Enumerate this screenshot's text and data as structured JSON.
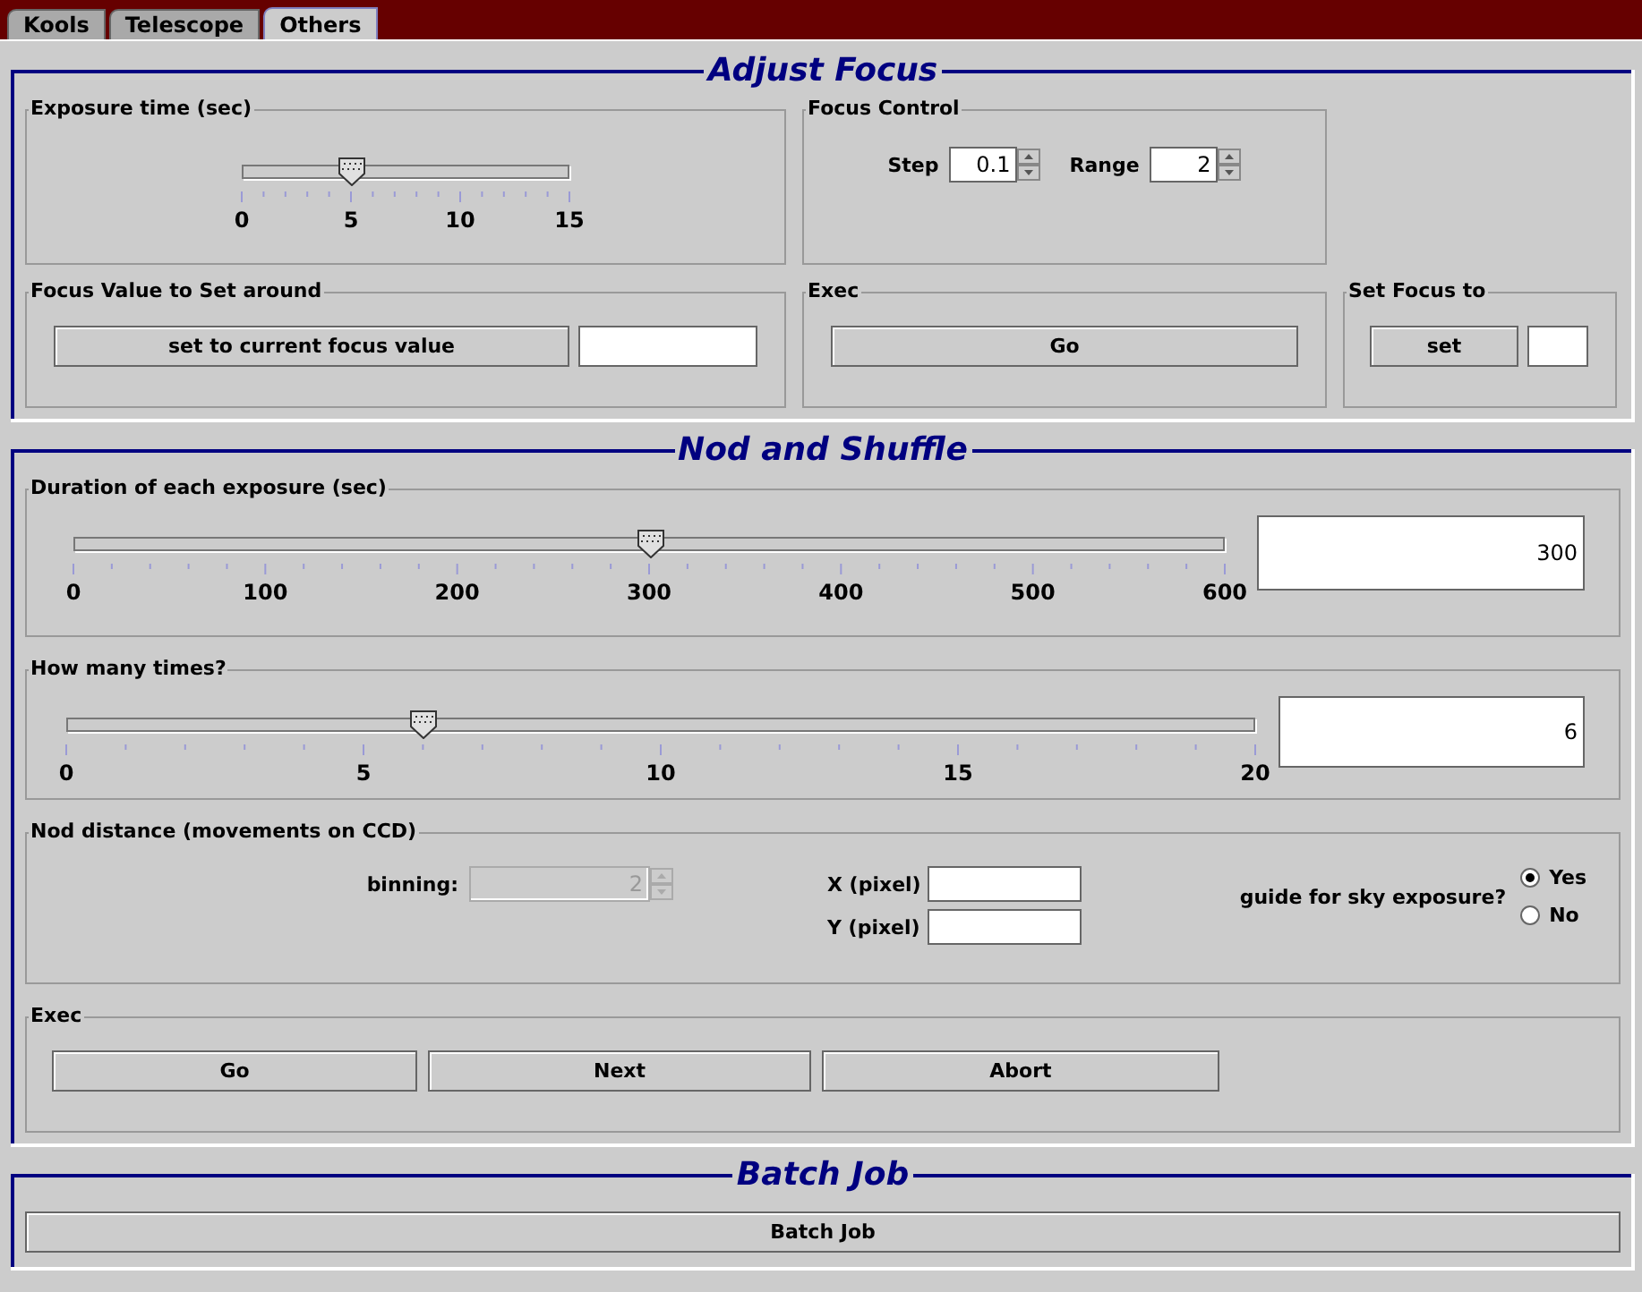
{
  "tabs": [
    {
      "label": "Kools",
      "selected": false
    },
    {
      "label": "Telescope",
      "selected": false
    },
    {
      "label": "Others",
      "selected": true
    }
  ],
  "adjust_focus": {
    "title": "Adjust Focus",
    "exposure": {
      "title": "Exposure time (sec)",
      "level": 0.333,
      "labels": [
        "0",
        "5",
        "10",
        "15"
      ]
    },
    "focus_control": {
      "title": "Focus Control",
      "spinners": [
        {
          "label": "Step",
          "value": "0.1"
        },
        {
          "label": "Range",
          "value": "2"
        }
      ]
    },
    "focus_value": {
      "title": "Focus Value to Set around",
      "button": "set to current focus value"
    },
    "exec": {
      "title": "Exec",
      "button": "Go"
    },
    "set_focus": {
      "title": "Set Focus to",
      "button": "set"
    }
  },
  "nod_and_shuffle": {
    "title": "Nod and Shuffle",
    "duration": {
      "title": "Duration of each exposure (sec)",
      "level": 0.5,
      "labels": [
        "0",
        "100",
        "200",
        "300",
        "400",
        "500",
        "600"
      ],
      "value": "300"
    },
    "times": {
      "title": "How many times?",
      "level": 0.3,
      "labels": [
        "0",
        "5",
        "10",
        "15",
        "20"
      ],
      "value": "6"
    },
    "nod_distance": {
      "title": "Nod distance (movements on CCD)",
      "binning": {
        "label": "binning:",
        "value": "2",
        "disabled": true
      },
      "fields": [
        {
          "label": "X (pixel)"
        },
        {
          "label": "Y (pixel)"
        }
      ],
      "guide": {
        "label": "guide for sky exposure?",
        "options": [
          {
            "label": "Yes",
            "selected": true
          },
          {
            "label": "No",
            "selected": false
          }
        ]
      }
    },
    "exec": {
      "title": "Exec",
      "buttons": [
        "Go",
        "Next",
        "Abort"
      ]
    }
  },
  "batch_job": {
    "title": "Batch Job",
    "button": "Batch Job"
  }
}
